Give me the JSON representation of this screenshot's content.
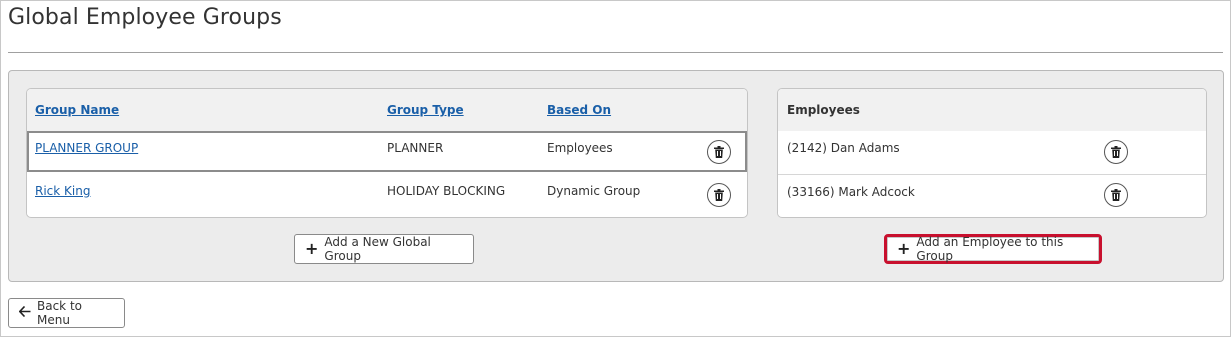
{
  "page": {
    "title": "Global Employee Groups"
  },
  "groups_table": {
    "headers": {
      "name": "Group Name",
      "type": "Group Type",
      "based_on": "Based On"
    },
    "rows": [
      {
        "name": "PLANNER GROUP",
        "type": "PLANNER",
        "based_on": "Employees",
        "delete_icon": "trash-icon"
      },
      {
        "name": "Rick King",
        "type": "HOLIDAY BLOCKING",
        "based_on": "Dynamic Group",
        "delete_icon": "trash-icon"
      }
    ]
  },
  "employees_table": {
    "header": "Employees",
    "rows": [
      {
        "name": "(2142) Dan Adams",
        "delete_icon": "trash-icon"
      },
      {
        "name": "(33166) Mark Adcock",
        "delete_icon": "trash-icon"
      }
    ]
  },
  "buttons": {
    "add_group": {
      "icon": "plus-icon",
      "label": "Add a New Global Group"
    },
    "add_employee": {
      "icon": "plus-icon",
      "label": "Add an Employee to this Group",
      "highlight_color": "#c8102e"
    },
    "back": {
      "icon": "arrow-left-icon",
      "label": "Back to Menu"
    }
  },
  "colors": {
    "link": "#1a5fa8",
    "panel_bg": "#ececec"
  }
}
